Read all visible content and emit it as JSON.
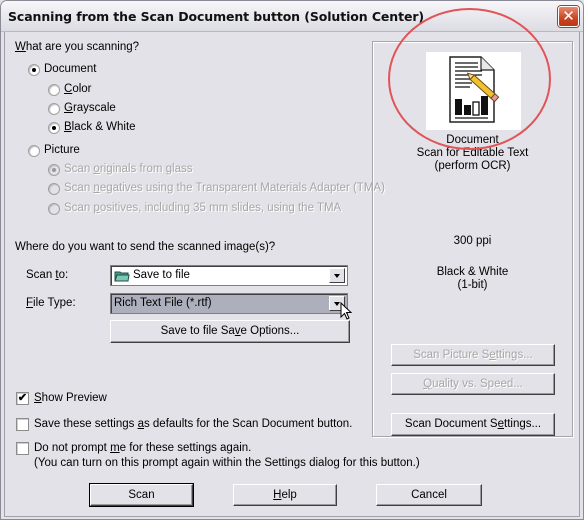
{
  "window": {
    "title": "Scanning from the Scan Document button (Solution Center)",
    "close_label": "✕"
  },
  "scanning": {
    "heading_prefix": "",
    "heading_accel": "W",
    "heading_rest": "hat are you scanning?",
    "document": {
      "label": "Document",
      "checked": true
    },
    "color_modes": [
      {
        "accel": "C",
        "rest": "olor",
        "checked": false
      },
      {
        "accel": "G",
        "rest": "rayscale",
        "checked": false
      },
      {
        "accel": "B",
        "rest": "lack & White",
        "checked": true
      }
    ],
    "picture": {
      "label": "Picture",
      "checked": false
    },
    "picture_options": [
      {
        "pre": "Scan ",
        "accel": "o",
        "rest": "riginals from glass",
        "checked": true,
        "disabled": true
      },
      {
        "pre": "Scan ",
        "accel": "n",
        "rest": "egatives using the Transparent Materials Adapter (TMA)",
        "checked": false,
        "disabled": true
      },
      {
        "pre": "Scan ",
        "accel": "p",
        "rest": "ositives, including 35 mm slides, using the TMA",
        "checked": false,
        "disabled": true
      }
    ]
  },
  "destination": {
    "heading": "Where do you want to send the scanned image(s)?",
    "scan_to": {
      "label_pre": "Scan ",
      "label_accel": "t",
      "label_rest": "o:",
      "value": "Save to file",
      "icon": "folder-icon"
    },
    "file_type": {
      "label_accel": "F",
      "label_rest": "ile Type:",
      "value": "Rich Text File (*.rtf)"
    },
    "save_options_button": {
      "pre": "Save to file Sa",
      "accel": "v",
      "rest": "e Options..."
    }
  },
  "preview": {
    "icon": "ocr-document-icon",
    "line1": "Document",
    "line2": "Scan for Editable Text",
    "line3": "(perform OCR)",
    "resolution": "300 ppi",
    "mode_line1": "Black & White",
    "mode_line2": "(1-bit)",
    "highlight_color": "#e05558"
  },
  "side_buttons": {
    "picture_settings": {
      "pre": "Scan Picture S",
      "accel": "e",
      "rest": "ttings...",
      "disabled": true
    },
    "quality_speed": {
      "pre": "",
      "accel": "Q",
      "rest": "uality vs. Speed...",
      "disabled": true
    },
    "document_settings": {
      "pre": "Scan Document S",
      "accel": "e",
      "rest": "ttings...",
      "disabled": false
    }
  },
  "options": {
    "show_preview": {
      "accel": "S",
      "rest": "how Preview",
      "checked": true
    },
    "save_defaults": {
      "pre": "Save these settings ",
      "accel": "a",
      "rest": "s defaults for the Scan Document button.",
      "checked": false
    },
    "do_not_prompt": {
      "pre": "Do not prompt ",
      "accel": "m",
      "rest": "e for these settings again.",
      "note": "(You can turn on this prompt again within the Settings dialog for this button.)",
      "checked": false
    }
  },
  "footer": {
    "scan": "Scan",
    "help_accel": "H",
    "help_rest": "elp",
    "cancel": "Cancel"
  }
}
